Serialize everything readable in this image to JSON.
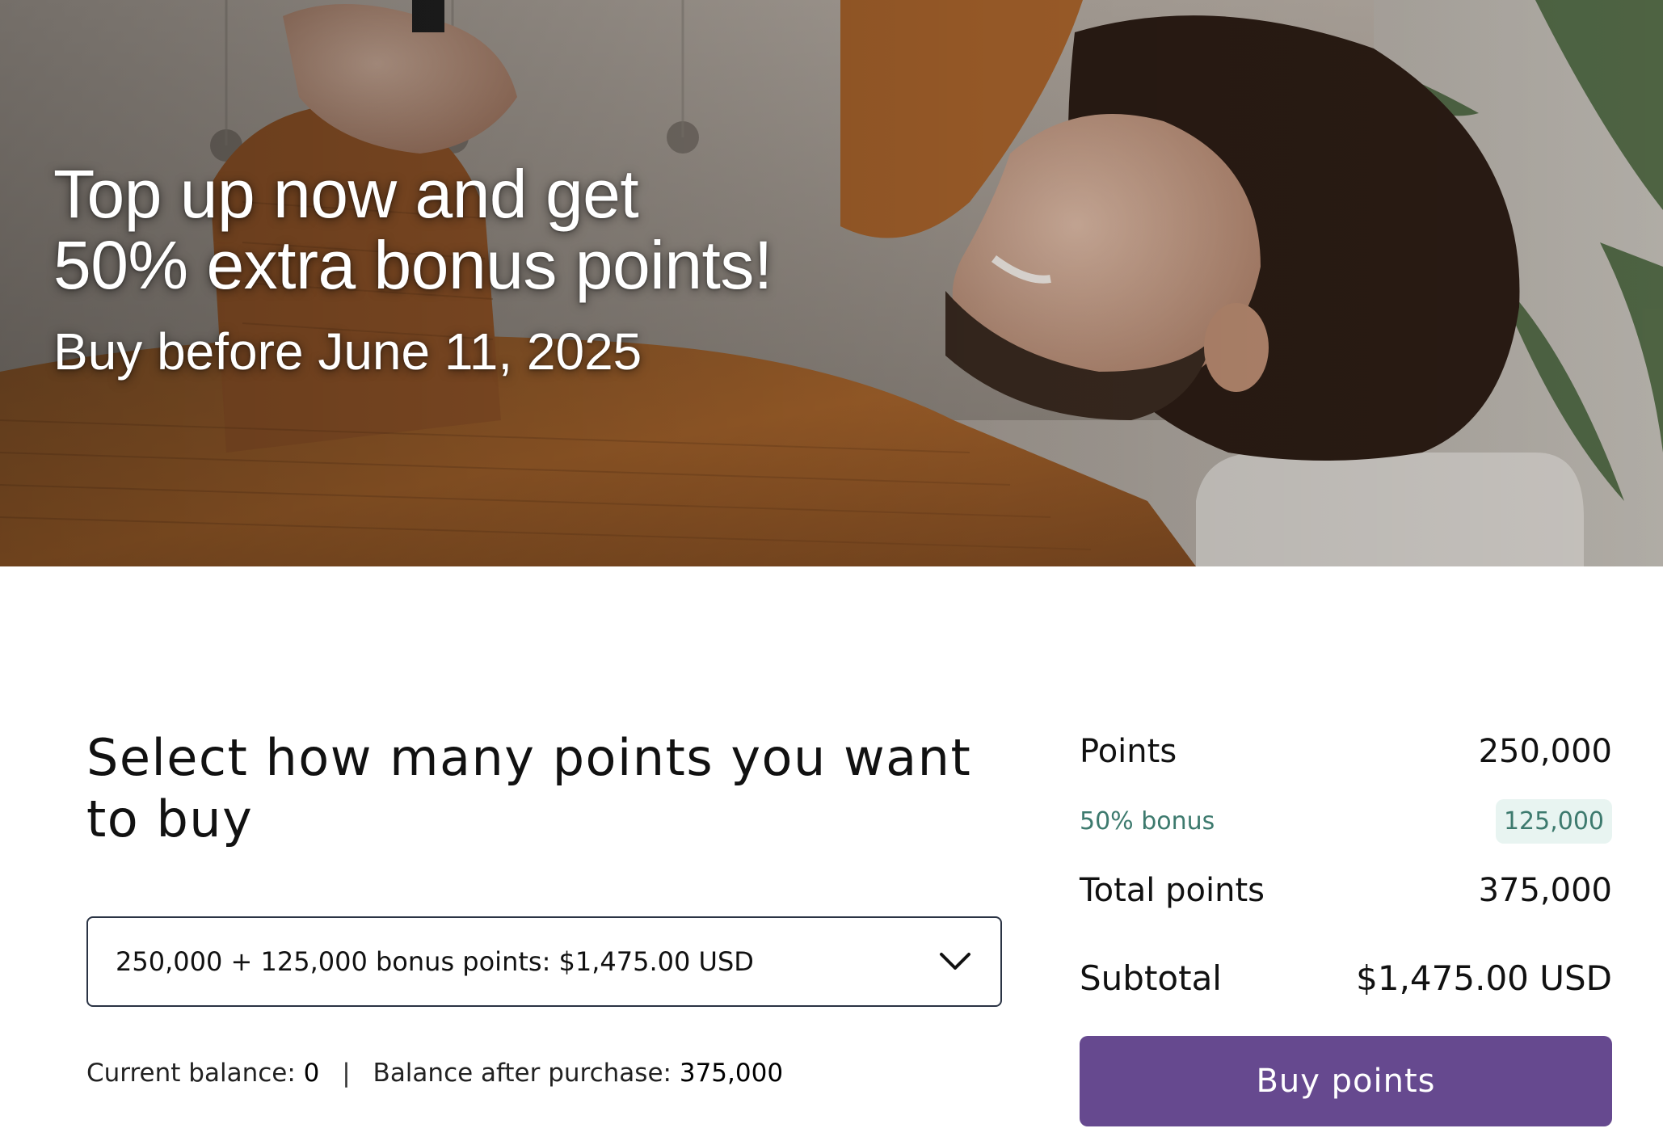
{
  "hero": {
    "headline_line1": "Top up now and get",
    "headline_line2": "50% extra bonus points!",
    "subline": "Buy before June 11, 2025"
  },
  "selection": {
    "title": "Select how many points you want to buy",
    "dropdown_value": "250,000 + 125,000 bonus points: $1,475.00 USD",
    "dropdown_icon": "chevron-down-icon",
    "current_balance_label": "Current balance:",
    "current_balance_value": "0",
    "separator": "|",
    "balance_after_label": "Balance after purchase:",
    "balance_after_value": "375,000"
  },
  "summary": {
    "points_label": "Points",
    "points_value": "250,000",
    "bonus_label": "50% bonus",
    "bonus_value": "125,000",
    "total_label": "Total points",
    "total_value": "375,000",
    "subtotal_label": "Subtotal",
    "subtotal_value": "$1,475.00 USD",
    "buy_button_label": "Buy points"
  },
  "colors": {
    "primary_button": "#66498f",
    "bonus_text": "#3d7a6e",
    "bonus_pill_bg": "#e8f4f1",
    "dropdown_border": "#2a3344"
  }
}
